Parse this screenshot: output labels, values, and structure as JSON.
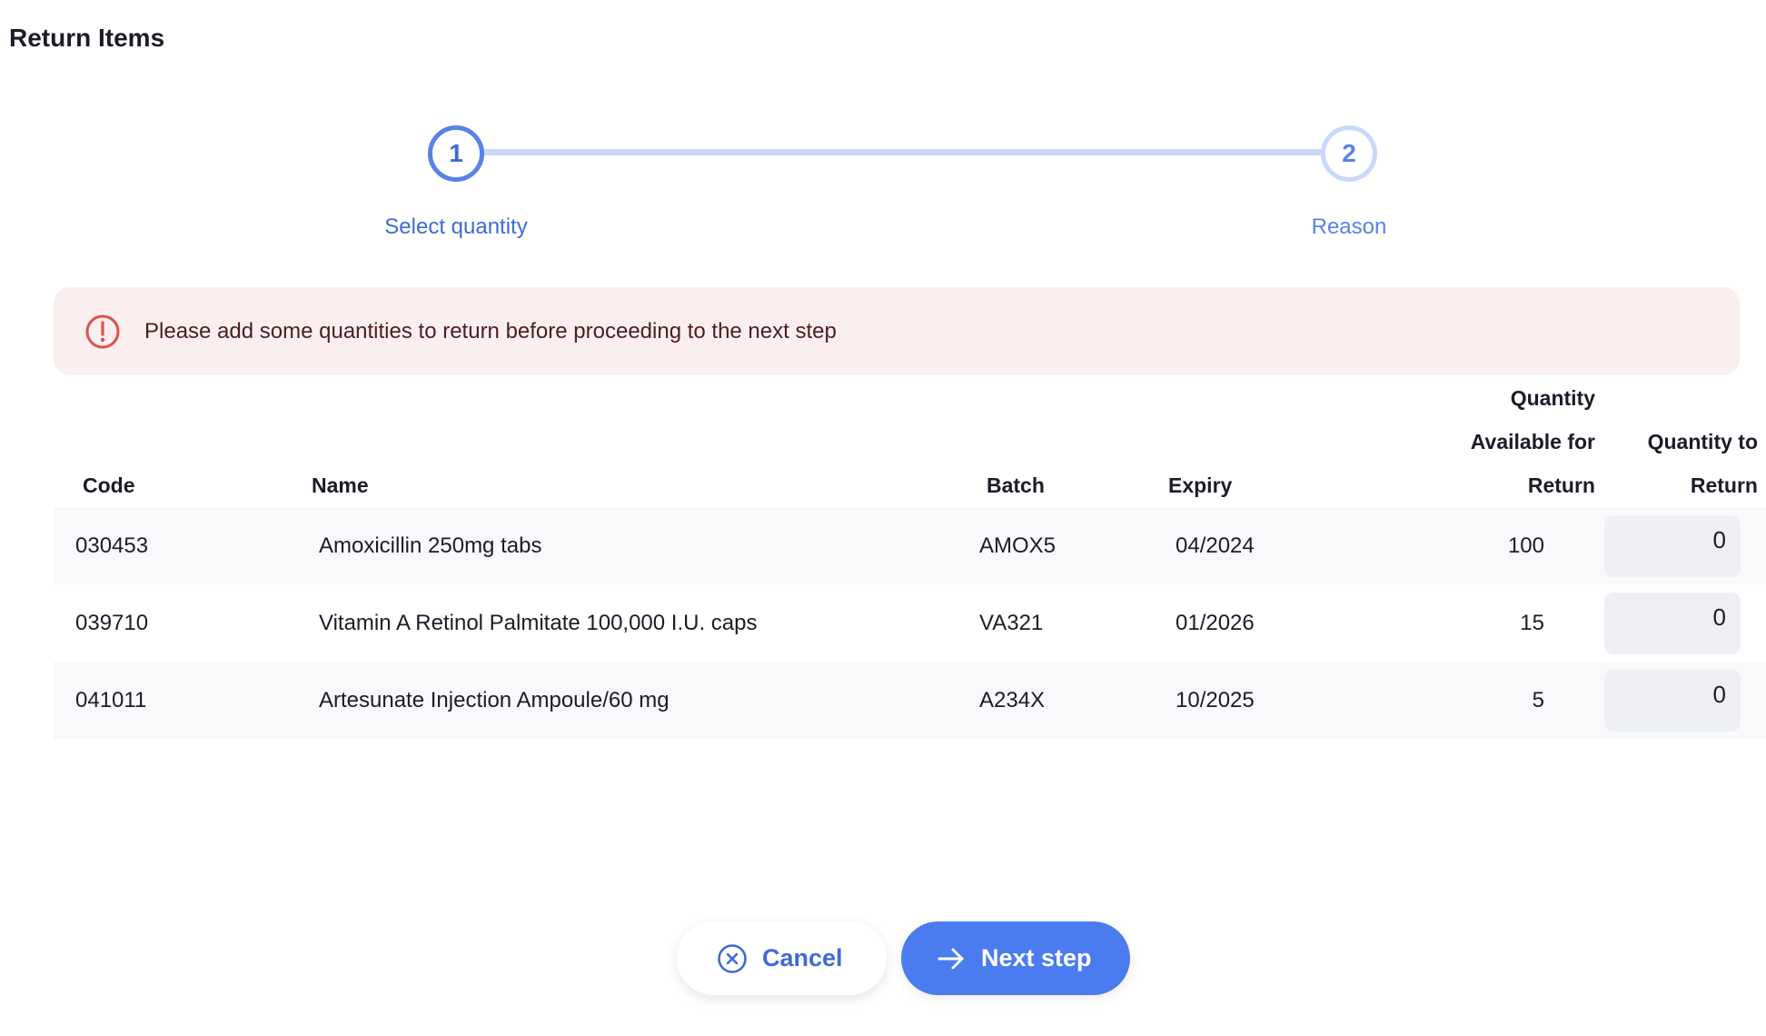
{
  "page": {
    "title": "Return Items"
  },
  "stepper": {
    "steps": [
      {
        "number": "1",
        "label": "Select quantity",
        "state": "active"
      },
      {
        "number": "2",
        "label": "Reason",
        "state": "inactive"
      }
    ]
  },
  "alert": {
    "icon": "exclamation-circle-icon",
    "message": "Please add some quantities to return before proceeding to the next step",
    "color": "#d9534f"
  },
  "table": {
    "headers": {
      "code": "Code",
      "name": "Name",
      "batch": "Batch",
      "expiry": "Expiry",
      "available_line1": "Quantity",
      "available_line2": "Available for",
      "available_line3": "Return",
      "to_return_line1": "Quantity to",
      "to_return_line2": "Return"
    },
    "rows": [
      {
        "code": "030453",
        "name": "Amoxicillin 250mg tabs",
        "batch": "AMOX5",
        "expiry": "04/2024",
        "available": "100",
        "to_return": "0"
      },
      {
        "code": "039710",
        "name": "Vitamin A Retinol Palmitate 100,000 I.U. caps",
        "batch": "VA321",
        "expiry": "01/2026",
        "available": "15",
        "to_return": "0"
      },
      {
        "code": "041011",
        "name": "Artesunate Injection Ampoule/60 mg",
        "batch": "A234X",
        "expiry": "10/2025",
        "available": "5",
        "to_return": "0"
      }
    ]
  },
  "actions": {
    "cancel_label": "Cancel",
    "cancel_icon": "x-circle-icon",
    "next_label": "Next step",
    "next_icon": "arrow-right-icon",
    "accent": "#4a7cf0"
  }
}
